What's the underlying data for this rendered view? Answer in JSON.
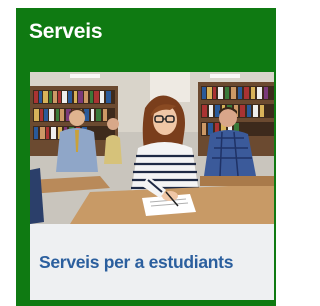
{
  "section": {
    "title": "Serveis"
  },
  "card": {
    "image_icon": "students-in-classroom-photo",
    "label": "Serveis per a estudiants"
  },
  "colors": {
    "panel_bg": "#0f7a12",
    "title_text": "#ffffff",
    "caption_bg": "#eef0f2",
    "caption_text": "#2b5f9e"
  }
}
